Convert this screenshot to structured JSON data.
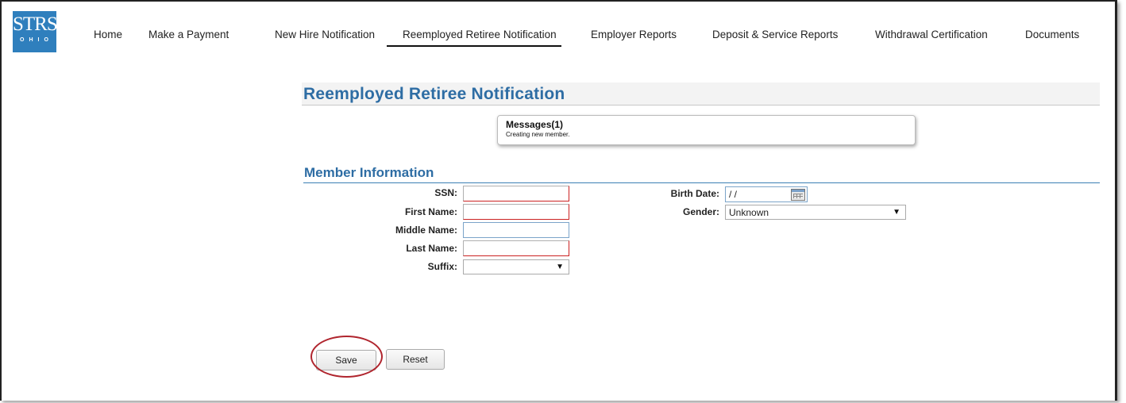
{
  "logo": {
    "top": "STRS",
    "bottom": "OHIO"
  },
  "nav": {
    "items": [
      "Home",
      "Make a Payment",
      "New Hire Notification",
      "Reemployed Retiree Notification",
      "Employer Reports",
      "Deposit & Service Reports",
      "Withdrawal Certification",
      "Documents"
    ],
    "active": "Reemployed Retiree Notification"
  },
  "page": {
    "title": "Reemployed Retiree Notification"
  },
  "messages": {
    "title": "Messages(1)",
    "body": "Creating new member."
  },
  "section": {
    "title": "Member Information"
  },
  "form": {
    "ssn_label": "SSN:",
    "first_name_label": "First Name:",
    "middle_name_label": "Middle Name:",
    "last_name_label": "Last Name:",
    "suffix_label": "Suffix:",
    "birth_date_label": "Birth Date:",
    "birth_date_value": " / /",
    "gender_label": "Gender:",
    "gender_value": "Unknown",
    "suffix_value": ""
  },
  "buttons": {
    "save": "Save",
    "reset": "Reset"
  },
  "colors": {
    "accent": "#2e6da4",
    "logo_bg": "#2f7fbd",
    "highlight": "#b0252e"
  }
}
